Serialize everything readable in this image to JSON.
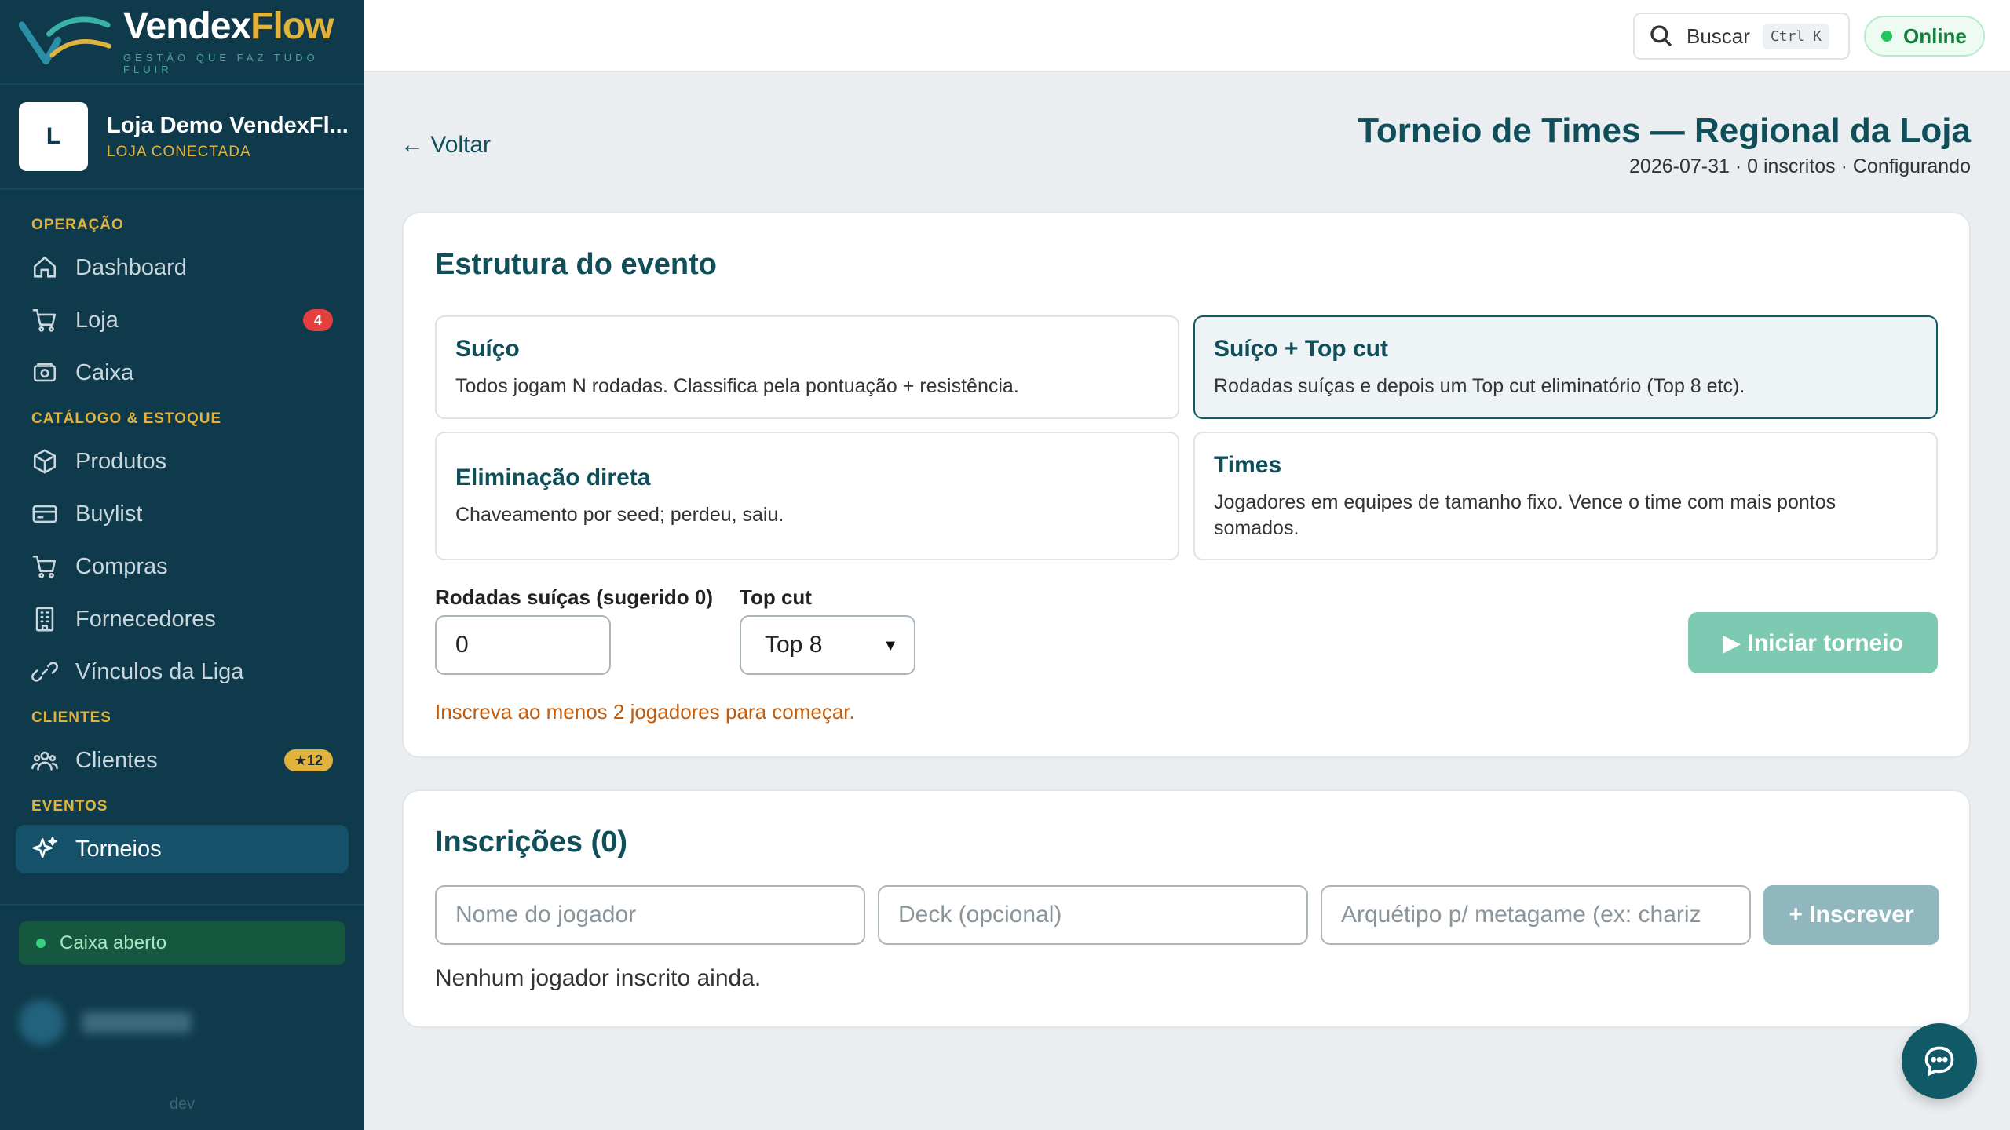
{
  "brand": {
    "name_part1": "Vendex",
    "name_part2": "Flow",
    "tagline": "GESTÃO QUE FAZ TUDO FLUIR"
  },
  "store": {
    "avatar": "L",
    "name": "Loja Demo VendexFl...",
    "status": "LOJA CONECTADA"
  },
  "sidebar": {
    "sections": [
      {
        "title": "OPERAÇÃO",
        "items": [
          {
            "label": "Dashboard",
            "icon": "home-icon"
          },
          {
            "label": "Loja",
            "icon": "cart-icon",
            "badge": "4"
          },
          {
            "label": "Caixa",
            "icon": "cash-register-icon"
          }
        ]
      },
      {
        "title": "CATÁLOGO & ESTOQUE",
        "items": [
          {
            "label": "Produtos",
            "icon": "box-icon"
          },
          {
            "label": "Buylist",
            "icon": "card-icon"
          },
          {
            "label": "Compras",
            "icon": "cart-icon"
          },
          {
            "label": "Fornecedores",
            "icon": "building-icon"
          },
          {
            "label": "Vínculos da Liga",
            "icon": "link-icon"
          }
        ]
      },
      {
        "title": "CLIENTES",
        "items": [
          {
            "label": "Clientes",
            "icon": "users-icon",
            "badge": "★12"
          }
        ]
      },
      {
        "title": "EVENTOS",
        "items": [
          {
            "label": "Torneios",
            "icon": "sparkles-icon",
            "active": true
          }
        ]
      }
    ],
    "caixa_status": "Caixa aberto",
    "env": "dev"
  },
  "topbar": {
    "search_label": "Buscar",
    "search_shortcut": "Ctrl K",
    "status": "Online"
  },
  "header": {
    "back": "← Voltar",
    "title": "Torneio de Times — Regional da Loja",
    "subtitle": "2026-07-31 · 0 inscritos · Configurando"
  },
  "structure": {
    "title": "Estrutura do evento",
    "options": [
      {
        "title": "Suíço",
        "desc": "Todos jogam N rodadas. Classifica pela pontuação + resistência.",
        "selected": false
      },
      {
        "title": "Suíço + Top cut",
        "desc": "Rodadas suíças e depois um Top cut eliminatório (Top 8 etc).",
        "selected": true
      },
      {
        "title": "Eliminação direta",
        "desc": "Chaveamento por seed; perdeu, saiu.",
        "selected": false
      },
      {
        "title": "Times",
        "desc": "Jogadores em equipes de tamanho fixo. Vence o time com mais pontos somados.",
        "selected": false
      }
    ],
    "rounds_label": "Rodadas suíças (sugerido 0)",
    "rounds_value": "0",
    "topcut_label": "Top cut",
    "topcut_value": "Top 8",
    "start_button": "▶ Iniciar torneio",
    "warning": "Inscreva ao menos 2 jogadores para começar."
  },
  "registrations": {
    "title": "Inscrições (0)",
    "player_placeholder": "Nome do jogador",
    "deck_placeholder": "Deck (opcional)",
    "archetype_placeholder": "Arquétipo p/ metagame (ex: chariz",
    "add_button": "+ Inscrever",
    "empty": "Nenhum jogador inscrito ainda."
  },
  "colors": {
    "sidebar": "#0f3a4b",
    "accent": "#0f4f5a",
    "gold": "#e2b33c",
    "warning": "#c25a07",
    "online": "#17803d"
  }
}
